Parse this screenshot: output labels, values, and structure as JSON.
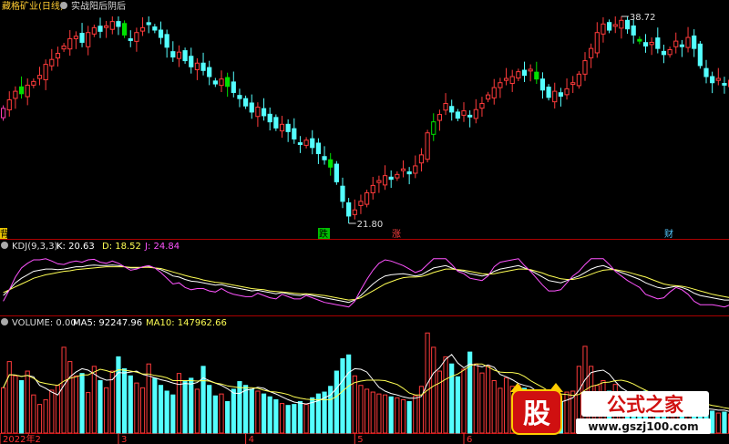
{
  "title_bar": {
    "stock_name": "藏格矿业(日线)",
    "indicator_name": "实战阳后阴后"
  },
  "price_panel": {
    "high_label": "38.72",
    "low_label": "21.80",
    "marker_left": "背",
    "marker_drop": "跌",
    "marker_rise": "涨",
    "marker_wealth": "财"
  },
  "kdj_panel": {
    "name": "KDJ(9,3,3)",
    "k_label": "K: 20.63",
    "d_label": "D: 18.52",
    "j_label": "J: 24.84"
  },
  "volume_panel": {
    "name": "VOLUME: 0.00",
    "ma5_label": "MA5: 92247.96",
    "ma10_label": "MA10: 147962.66"
  },
  "date_axis": [
    "2022年2",
    "3",
    "4",
    "5",
    "6"
  ],
  "watermark": {
    "badge_char": "股",
    "brand": "公式之家",
    "url": "www.gszj100.com"
  },
  "colors": {
    "up": "#ff3b3b",
    "down": "#54ffff",
    "neutral_bar": "#888888",
    "k_line": "#ffffff",
    "d_line": "#ffff54",
    "j_line": "#ff54ff",
    "panel_sep": "#990000",
    "accent": "#ff3030",
    "green_highlight": "#00e000",
    "magenta_highlight": "#ff3cb4"
  },
  "chart_data": [
    {
      "type": "candlestick",
      "title": "藏格矿业(日线)",
      "annotations": [
        "38.72",
        "21.80"
      ],
      "ylim": [
        21.8,
        38.72
      ],
      "close": [
        31.2,
        31.9,
        32.6,
        32.4,
        33.1,
        33.4,
        33.9,
        34.8,
        35.2,
        35.7,
        36.3,
        36.9,
        37.1,
        36.6,
        37.4,
        37.8,
        37.5,
        37.9,
        38.3,
        37.9,
        37.2,
        36.8,
        37.4,
        37.8,
        38.1,
        37.6,
        37.0,
        36.2,
        35.4,
        35.8,
        35.1,
        34.6,
        34.9,
        34.3,
        33.8,
        33.2,
        33.6,
        33.0,
        32.5,
        32.0,
        31.4,
        30.9,
        31.3,
        30.6,
        30.1,
        29.6,
        29.9,
        29.3,
        28.7,
        28.3,
        28.6,
        28.0,
        27.5,
        27.0,
        26.4,
        25.2,
        23.6,
        22.4,
        22.9,
        23.6,
        24.3,
        24.9,
        25.3,
        25.7,
        25.4,
        25.8,
        26.2,
        25.9,
        26.5,
        27.4,
        29.2,
        30.1,
        30.7,
        31.6,
        30.9,
        30.4,
        31.0,
        30.5,
        31.1,
        31.6,
        32.3,
        32.9,
        33.3,
        33.6,
        33.8,
        34.2,
        33.9,
        34.4,
        33.6,
        32.7,
        32.1,
        32.6,
        32.2,
        32.8,
        33.3,
        34.0,
        35.1,
        36.1,
        37.4,
        38.1,
        37.6,
        38.0,
        38.4,
        37.7,
        37.2,
        36.7,
        36.3,
        36.6,
        36.1,
        35.6,
        36.0,
        36.7,
        36.3,
        37.0,
        36.1,
        34.7,
        33.8,
        33.3,
        33.6,
        33.1,
        33.5
      ],
      "volume": [
        95000,
        150000,
        120000,
        110000,
        130000,
        80000,
        60000,
        70000,
        90000,
        100000,
        180000,
        150000,
        120000,
        125000,
        85000,
        140000,
        110000,
        95000,
        130000,
        160000,
        135000,
        120000,
        105000,
        95000,
        145000,
        115000,
        100000,
        88000,
        80000,
        125000,
        108000,
        115000,
        92000,
        140000,
        100000,
        78000,
        82000,
        66000,
        92000,
        108000,
        100000,
        92000,
        88000,
        82000,
        76000,
        70000,
        62000,
        58000,
        60000,
        66000,
        60000,
        74000,
        82000,
        86000,
        98000,
        130000,
        156000,
        164000,
        120000,
        100000,
        92000,
        86000,
        82000,
        80000,
        76000,
        74000,
        70000,
        66000,
        78000,
        98000,
        210000,
        180000,
        130000,
        160000,
        145000,
        118000,
        134000,
        170000,
        145000,
        126000,
        140000,
        110000,
        94000,
        116000,
        98000,
        100000,
        94000,
        78000,
        68000,
        62000,
        58000,
        72000,
        66000,
        86000,
        88000,
        140000,
        182000,
        140000,
        100000,
        110000,
        88000,
        102000,
        76000,
        58000,
        50000,
        60000,
        88000,
        70000,
        64000,
        72000,
        60000,
        56000,
        50000,
        50000,
        48000,
        52000,
        54000,
        46000,
        42000,
        44000,
        40000
      ]
    },
    {
      "type": "line",
      "title": "KDJ(9,3,3)",
      "series": [
        {
          "name": "K",
          "values": [
            30,
            40,
            52,
            60,
            66,
            72,
            74,
            76,
            76,
            75,
            76,
            78,
            80,
            80,
            82,
            83,
            82,
            82,
            83,
            82,
            80,
            78,
            78,
            79,
            80,
            78,
            75,
            70,
            64,
            62,
            58,
            55,
            54,
            52,
            50,
            48,
            49,
            46,
            44,
            42,
            40,
            38,
            39,
            37,
            35,
            33,
            35,
            33,
            31,
            30,
            32,
            30,
            28,
            26,
            24,
            22,
            20,
            18,
            22,
            30,
            40,
            50,
            58,
            64,
            66,
            67,
            68,
            66,
            64,
            66,
            72,
            78,
            80,
            82,
            78,
            74,
            72,
            68,
            66,
            64,
            66,
            72,
            76,
            78,
            80,
            82,
            78,
            74,
            68,
            62,
            56,
            54,
            52,
            56,
            60,
            64,
            70,
            76,
            80,
            82,
            78,
            74,
            70,
            66,
            62,
            58,
            52,
            48,
            44,
            42,
            44,
            46,
            44,
            40,
            34,
            30,
            28,
            26,
            24,
            22,
            22
          ]
        },
        {
          "name": "D",
          "values": [
            35,
            40,
            45,
            50,
            55,
            60,
            63,
            66,
            68,
            70,
            72,
            73,
            75,
            76,
            77,
            78,
            79,
            80,
            80,
            80,
            80,
            79,
            79,
            79,
            79,
            78,
            77,
            74,
            71,
            68,
            65,
            62,
            60,
            57,
            55,
            53,
            52,
            50,
            48,
            46,
            44,
            42,
            41,
            40,
            38,
            37,
            36,
            35,
            34,
            33,
            33,
            32,
            31,
            30,
            28,
            26,
            24,
            22,
            23,
            26,
            32,
            38,
            44,
            50,
            54,
            58,
            61,
            62,
            62,
            63,
            66,
            70,
            73,
            76,
            76,
            75,
            74,
            72,
            70,
            68,
            67,
            68,
            70,
            72,
            74,
            76,
            76,
            75,
            72,
            69,
            65,
            62,
            59,
            58,
            58,
            60,
            63,
            67,
            71,
            74,
            75,
            75,
            73,
            71,
            68,
            65,
            62,
            58,
            54,
            50,
            48,
            47,
            46,
            44,
            41,
            38,
            35,
            32,
            30,
            28,
            26
          ]
        },
        {
          "name": "J",
          "values": [
            20,
            40,
            62,
            78,
            86,
            92,
            92,
            94,
            90,
            85,
            84,
            88,
            90,
            88,
            92,
            93,
            88,
            86,
            90,
            86,
            80,
            74,
            76,
            80,
            82,
            78,
            70,
            60,
            50,
            52,
            44,
            40,
            42,
            42,
            38,
            36,
            42,
            36,
            32,
            30,
            28,
            28,
            34,
            30,
            26,
            24,
            32,
            28,
            24,
            24,
            30,
            26,
            22,
            18,
            16,
            14,
            12,
            10,
            20,
            40,
            58,
            74,
            86,
            92,
            90,
            86,
            82,
            76,
            70,
            74,
            84,
            94,
            94,
            94,
            84,
            72,
            68,
            60,
            58,
            56,
            64,
            80,
            88,
            90,
            92,
            94,
            82,
            72,
            60,
            48,
            38,
            38,
            40,
            52,
            64,
            72,
            84,
            94,
            94,
            94,
            84,
            72,
            64,
            56,
            50,
            44,
            32,
            28,
            24,
            26,
            36,
            44,
            40,
            32,
            20,
            14,
            14,
            14,
            12,
            10,
            14
          ]
        }
      ]
    },
    {
      "type": "line",
      "title": "VOLUME: 0.00",
      "series": [
        {
          "name": "MA5",
          "values": [
            95000,
            122500,
            121667,
            118750,
            121000,
            118000,
            100000,
            94000,
            86000,
            80000,
            100000,
            118000,
            128000,
            135000,
            132000,
            124000,
            116000,
            111000,
            112000,
            127000,
            126000,
            128000,
            130000,
            123000,
            120000,
            116000,
            112000,
            109000,
            105000,
            102000,
            104000,
            103000,
            106000,
            116000,
            110000,
            105000,
            100000,
            93000,
            84000,
            83000,
            90000,
            92000,
            96000,
            94000,
            87000,
            82000,
            76000,
            70000,
            65000,
            63000,
            61000,
            64000,
            68000,
            74000,
            80000,
            94000,
            110000,
            127000,
            135000,
            134000,
            128000,
            112000,
            96000,
            88000,
            83000,
            80000,
            76000,
            73000,
            73000,
            77000,
            104000,
            126000,
            137000,
            155000,
            165000,
            147000,
            137000,
            145000,
            142000,
            139000,
            143000,
            138000,
            123000,
            118000,
            112000,
            104000,
            100000,
            97000,
            88000,
            80000,
            72000,
            68000,
            65000,
            69000,
            74000,
            90000,
            112000,
            127000,
            130000,
            132000,
            124000,
            108000,
            95000,
            87000,
            75000,
            69000,
            72000,
            72000,
            68000,
            71000,
            71000,
            65000,
            60000,
            58000,
            53000,
            51000,
            51000,
            50000,
            48000,
            48000,
            45000
          ]
        },
        {
          "name": "MA10",
          "values": [
            95000,
            122500,
            121667,
            118750,
            121000,
            115000,
            107000,
            104000,
            102000,
            100000,
            109000,
            115000,
            118000,
            122000,
            122000,
            128000,
            134000,
            131000,
            127000,
            133000,
            132000,
            130000,
            128000,
            124000,
            124000,
            121000,
            119000,
            116000,
            110000,
            110000,
            110000,
            110000,
            109000,
            110000,
            109000,
            105000,
            103000,
            99000,
            97000,
            95000,
            95000,
            95000,
            94000,
            90000,
            87000,
            86000,
            84000,
            81000,
            76000,
            73000,
            71000,
            70000,
            70000,
            70000,
            70000,
            77000,
            88000,
            99000,
            106000,
            109000,
            111000,
            111000,
            111000,
            110000,
            106000,
            102000,
            94000,
            84000,
            80000,
            80000,
            90000,
            99000,
            105000,
            113000,
            119000,
            124000,
            132000,
            141000,
            145000,
            145000,
            139000,
            132000,
            128000,
            127000,
            127000,
            125000,
            119000,
            110000,
            103000,
            96000,
            88000,
            84000,
            82000,
            81000,
            79000,
            81000,
            90000,
            98000,
            101000,
            106000,
            107000,
            110000,
            111000,
            108000,
            103000,
            96000,
            90000,
            84000,
            82000,
            80000,
            75000,
            73000,
            72000,
            71000,
            67000,
            64000,
            61000,
            58000,
            56000,
            53000,
            51000
          ]
        }
      ]
    }
  ]
}
